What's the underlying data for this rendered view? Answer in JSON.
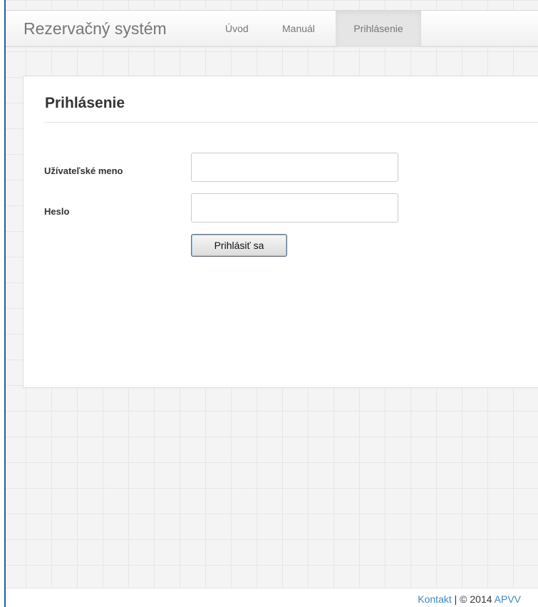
{
  "navbar": {
    "brand": "Rezervačný systém",
    "links": [
      {
        "label": "Úvod",
        "active": false
      },
      {
        "label": "Manuál",
        "active": false
      },
      {
        "label": "Prihlásenie",
        "active": true
      }
    ]
  },
  "login": {
    "title": "Prihlásenie",
    "username_label": "Užívateľské meno",
    "username_value": "",
    "password_label": "Heslo",
    "password_value": "",
    "submit_label": "Prihlásiť sa"
  },
  "footer": {
    "contact_link": "Kontakt",
    "separator": " | ",
    "copyright": "© 2014 ",
    "org_link": "APVV"
  },
  "colors": {
    "link": "#3b86c4",
    "nav_active_bg": "#e5e5e5",
    "text": "#333333"
  }
}
